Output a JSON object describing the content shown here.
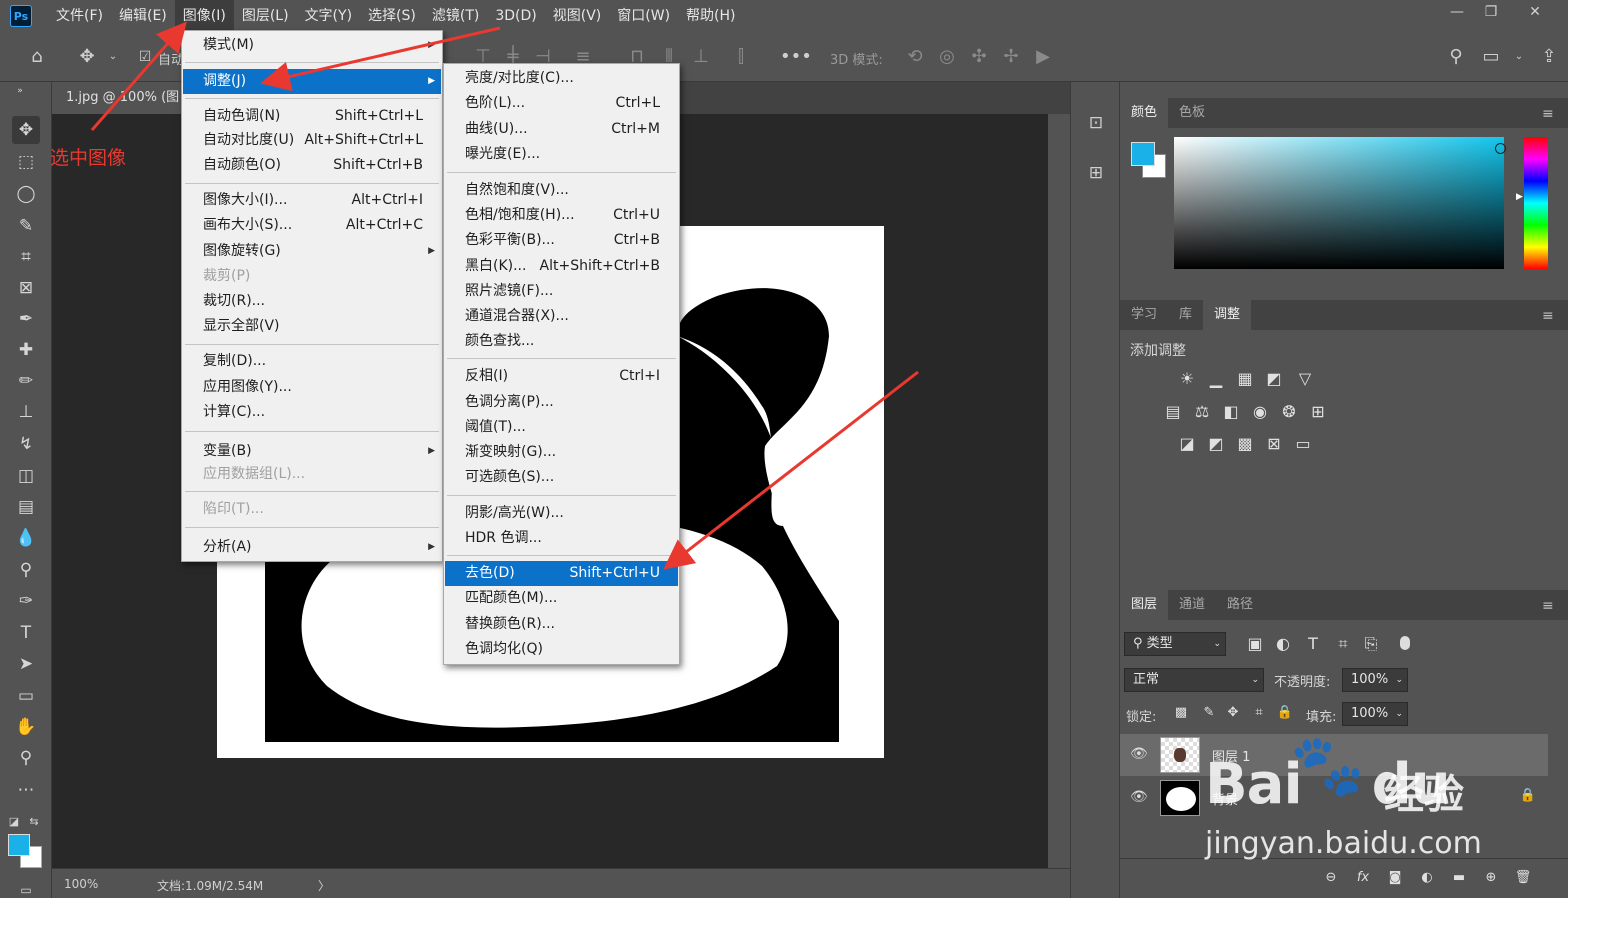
{
  "app": {
    "logo": "Ps"
  },
  "menubar": {
    "items": [
      "文件(F)",
      "编辑(E)",
      "图像(I)",
      "图层(L)",
      "文字(Y)",
      "选择(S)",
      "滤镜(T)",
      "3D(D)",
      "视图(V)",
      "窗口(W)",
      "帮助(H)"
    ],
    "active_index": 2
  },
  "window_controls": {
    "minimize": "—",
    "restore": "❐",
    "close": "✕"
  },
  "options_bar": {
    "auto_select_label": "自动",
    "mode_3d_label": "3D 模式:",
    "more": "•••"
  },
  "document": {
    "tab_title": "1.jpg @ 100% (图",
    "zoom": "100%",
    "doc_info": "文档:1.09M/2.54M",
    "status_arrow": "〉"
  },
  "annotation": {
    "text": "选中图像"
  },
  "image_menu": {
    "items": [
      {
        "label": "模式(M)",
        "shortcut": "",
        "submenu": true,
        "disabled": false
      },
      {
        "label": "调整(J)",
        "shortcut": "",
        "submenu": true,
        "disabled": false,
        "highlighted": true
      },
      {
        "label": "自动色调(N)",
        "shortcut": "Shift+Ctrl+L",
        "submenu": false,
        "disabled": false
      },
      {
        "label": "自动对比度(U)",
        "shortcut": "Alt+Shift+Ctrl+L",
        "submenu": false,
        "disabled": false
      },
      {
        "label": "自动颜色(O)",
        "shortcut": "Shift+Ctrl+B",
        "submenu": false,
        "disabled": false
      },
      {
        "label": "图像大小(I)...",
        "shortcut": "Alt+Ctrl+I",
        "submenu": false,
        "disabled": false
      },
      {
        "label": "画布大小(S)...",
        "shortcut": "Alt+Ctrl+C",
        "submenu": false,
        "disabled": false
      },
      {
        "label": "图像旋转(G)",
        "shortcut": "",
        "submenu": true,
        "disabled": false
      },
      {
        "label": "裁剪(P)",
        "shortcut": "",
        "submenu": false,
        "disabled": true
      },
      {
        "label": "裁切(R)...",
        "shortcut": "",
        "submenu": false,
        "disabled": false
      },
      {
        "label": "显示全部(V)",
        "shortcut": "",
        "submenu": false,
        "disabled": false
      },
      {
        "label": "复制(D)...",
        "shortcut": "",
        "submenu": false,
        "disabled": false
      },
      {
        "label": "应用图像(Y)...",
        "shortcut": "",
        "submenu": false,
        "disabled": false
      },
      {
        "label": "计算(C)...",
        "shortcut": "",
        "submenu": false,
        "disabled": false
      },
      {
        "label": "变量(B)",
        "shortcut": "",
        "submenu": true,
        "disabled": false
      },
      {
        "label": "应用数据组(L)...",
        "shortcut": "",
        "submenu": false,
        "disabled": true
      },
      {
        "label": "陷印(T)...",
        "shortcut": "",
        "submenu": false,
        "disabled": true
      },
      {
        "label": "分析(A)",
        "shortcut": "",
        "submenu": true,
        "disabled": false
      }
    ]
  },
  "adjust_submenu": {
    "items": [
      {
        "label": "亮度/对比度(C)...",
        "shortcut": ""
      },
      {
        "label": "色阶(L)...",
        "shortcut": "Ctrl+L"
      },
      {
        "label": "曲线(U)...",
        "shortcut": "Ctrl+M"
      },
      {
        "label": "曝光度(E)...",
        "shortcut": ""
      },
      {
        "label": "自然饱和度(V)...",
        "shortcut": ""
      },
      {
        "label": "色相/饱和度(H)...",
        "shortcut": "Ctrl+U"
      },
      {
        "label": "色彩平衡(B)...",
        "shortcut": "Ctrl+B"
      },
      {
        "label": "黑白(K)...",
        "shortcut": "Alt+Shift+Ctrl+B"
      },
      {
        "label": "照片滤镜(F)...",
        "shortcut": ""
      },
      {
        "label": "通道混合器(X)...",
        "shortcut": ""
      },
      {
        "label": "颜色查找...",
        "shortcut": ""
      },
      {
        "label": "反相(I)",
        "shortcut": "Ctrl+I"
      },
      {
        "label": "色调分离(P)...",
        "shortcut": ""
      },
      {
        "label": "阈值(T)...",
        "shortcut": ""
      },
      {
        "label": "渐变映射(G)...",
        "shortcut": ""
      },
      {
        "label": "可选颜色(S)...",
        "shortcut": ""
      },
      {
        "label": "阴影/高光(W)...",
        "shortcut": ""
      },
      {
        "label": "HDR 色调...",
        "shortcut": ""
      },
      {
        "label": "去色(D)",
        "shortcut": "Shift+Ctrl+U",
        "highlighted": true
      },
      {
        "label": "匹配颜色(M)...",
        "shortcut": ""
      },
      {
        "label": "替换颜色(R)...",
        "shortcut": ""
      },
      {
        "label": "色调均化(Q)",
        "shortcut": ""
      }
    ]
  },
  "color_panel": {
    "tabs": [
      "颜色",
      "色板"
    ],
    "active_tab": 0,
    "foreground": "#1ab0e8",
    "background": "#ffffff"
  },
  "adjust_panel": {
    "tabs": [
      "学习",
      "库",
      "调整"
    ],
    "active_tab": 2,
    "title": "添加调整"
  },
  "layers_panel": {
    "tabs": [
      "图层",
      "通道",
      "路径"
    ],
    "active_tab": 0,
    "filter_label": "类型",
    "blend_mode": "正常",
    "opacity_label": "不透明度:",
    "opacity_value": "100%",
    "lock_label": "锁定:",
    "fill_label": "填充:",
    "fill_value": "100%",
    "layers": [
      {
        "name": "图层 1",
        "selected": true,
        "locked": false
      },
      {
        "name": "背景",
        "selected": false,
        "locked": true
      }
    ]
  },
  "watermark": {
    "brand": "Bai",
    "brand2": "du",
    "suffix": "经验",
    "url": "jingyan.baidu.com"
  },
  "colors": {
    "accent": "#0c72c9",
    "annotation": "#e8382f",
    "canvas_bg": "#282828",
    "panel_bg": "#535353"
  }
}
